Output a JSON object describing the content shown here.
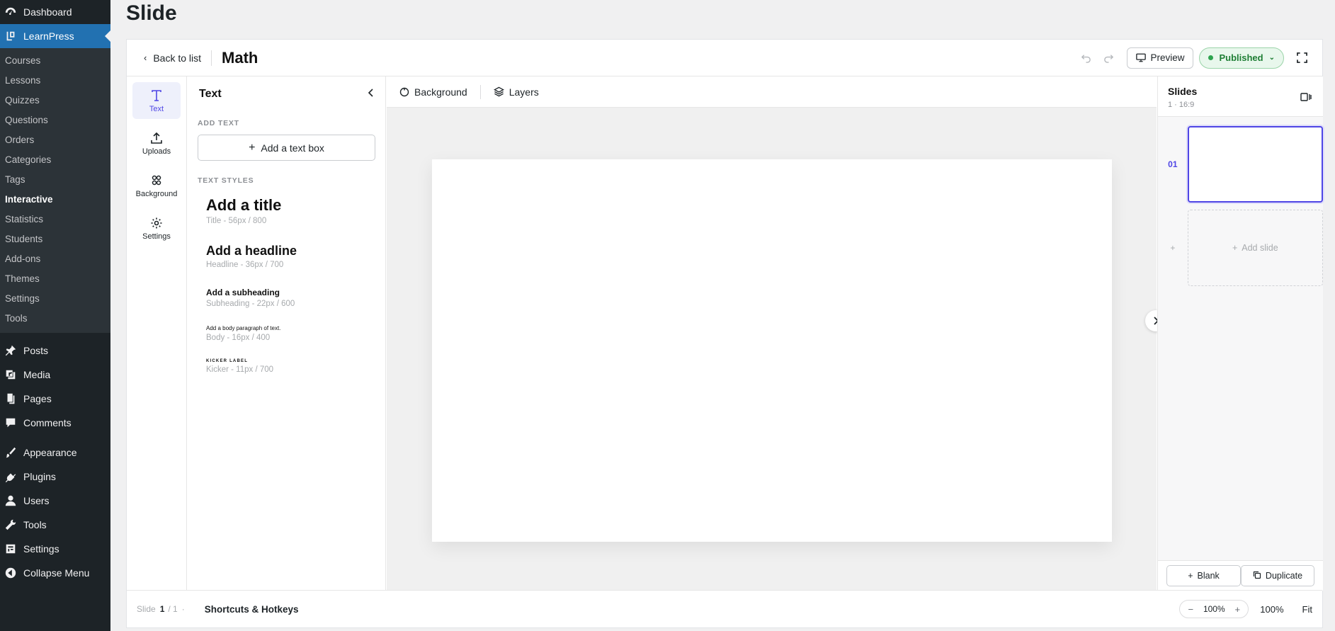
{
  "wp_menu": {
    "dashboard": "Dashboard",
    "learnpress": "LearnPress",
    "learnpress_sub": [
      "Courses",
      "Lessons",
      "Quizzes",
      "Questions",
      "Orders",
      "Categories",
      "Tags",
      "Interactive",
      "Statistics",
      "Students",
      "Add-ons",
      "Themes",
      "Settings",
      "Tools"
    ],
    "posts": "Posts",
    "media": "Media",
    "pages": "Pages",
    "comments": "Comments",
    "appearance": "Appearance",
    "plugins": "Plugins",
    "users": "Users",
    "tools": "Tools",
    "settings": "Settings",
    "collapse": "Collapse Menu"
  },
  "page": {
    "title": "Slide"
  },
  "topbar": {
    "back_label": "Back to list",
    "doc_title": "Math",
    "preview_label": "Preview",
    "status_label": "Published"
  },
  "tools": {
    "text": "Text",
    "uploads": "Uploads",
    "background": "Background",
    "settings": "Settings"
  },
  "text_panel": {
    "title": "Text",
    "add_text_label": "ADD TEXT",
    "add_textbox": "Add a text box",
    "styles_label": "TEXT STYLES",
    "styles": [
      {
        "name": "Add a title",
        "meta": "Title - 56px / 800"
      },
      {
        "name": "Add a headline",
        "meta": "Headline - 36px / 700"
      },
      {
        "name": "Add a subheading",
        "meta": "Subheading - 22px / 600"
      },
      {
        "name": "Add a body paragraph of text.",
        "meta": "Body - 16px / 400"
      },
      {
        "name": "KICKER LABEL",
        "meta": "Kicker - 11px / 700"
      }
    ]
  },
  "canvas_toolbar": {
    "background": "Background",
    "layers": "Layers"
  },
  "slides_panel": {
    "title": "Slides",
    "meta": "1 · 16:9",
    "slide_number": "01",
    "add_marker": "+",
    "add_slide": "Add slide",
    "blank": "Blank",
    "duplicate": "Duplicate"
  },
  "bottombar": {
    "slide_label": "Slide",
    "current": "1",
    "total": "/ 1",
    "shortcuts": "Shortcuts & Hotkeys",
    "zoom_value": "100%",
    "zoom_readout": "100%",
    "fit": "Fit"
  },
  "colors": {
    "accent": "#4f46e5",
    "wp_sidebar": "#1d2327",
    "wp_active": "#2271b1",
    "published_bg": "#e8f7ec",
    "published_text": "#1e7e34"
  }
}
